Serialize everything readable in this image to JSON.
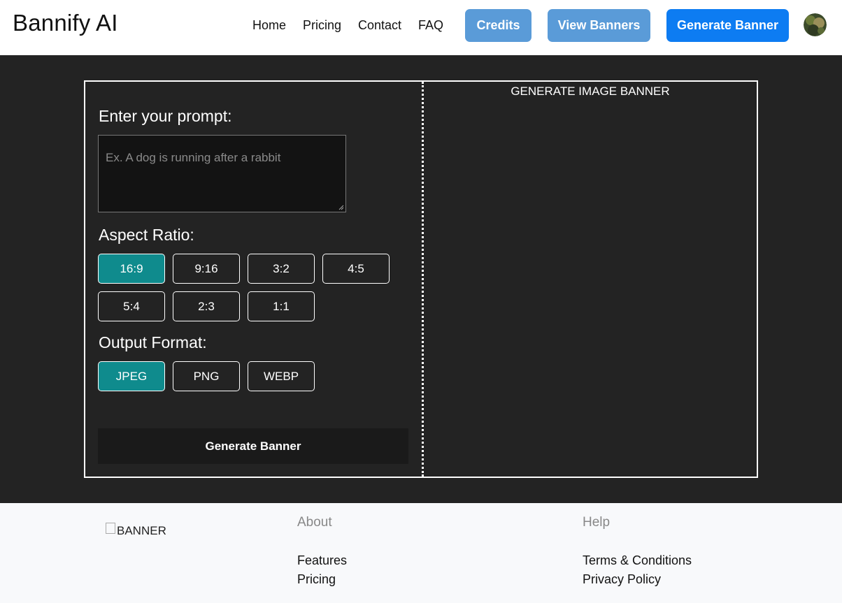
{
  "header": {
    "brand": "Bannify AI",
    "nav": [
      "Home",
      "Pricing",
      "Contact",
      "FAQ"
    ],
    "credits_label": "Credits",
    "view_banners_label": "View Banners",
    "generate_banner_label": "Generate Banner"
  },
  "form": {
    "prompt_label": "Enter your prompt:",
    "prompt_placeholder": "Ex. A dog is running after a rabbit",
    "prompt_value": "",
    "aspect_label": "Aspect Ratio:",
    "aspect_options": [
      "16:9",
      "9:16",
      "3:2",
      "4:5",
      "5:4",
      "2:3",
      "1:1"
    ],
    "aspect_selected": "16:9",
    "format_label": "Output Format:",
    "format_options": [
      "JPEG",
      "PNG",
      "WEBP"
    ],
    "format_selected": "JPEG",
    "submit_label": "Generate Banner"
  },
  "preview": {
    "title": "GENERATE IMAGE BANNER"
  },
  "footer": {
    "logo_alt": "BANNER",
    "about_heading": "About",
    "about_links": [
      "Features",
      "Pricing"
    ],
    "help_heading": "Help",
    "help_links": [
      "Terms & Conditions",
      "Privacy Policy"
    ]
  },
  "colors": {
    "background": "#232323",
    "selected": "#0f8b8d",
    "primary": "#0d7cf2",
    "light_primary": "#5a9bd8"
  }
}
